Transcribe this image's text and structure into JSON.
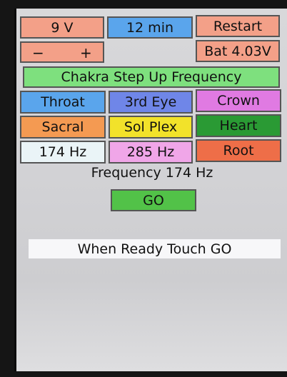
{
  "colors": {
    "salmon": "#f3a088",
    "blue": "#5aa5ec",
    "royal_blue": "#6f86e8",
    "magenta": "#e07ae2",
    "orange": "#f49a52",
    "yellow": "#f2e22a",
    "green": "#52c248",
    "dark_green": "#2a9a34",
    "light_green": "#7ee07e",
    "pink": "#f0a6e8",
    "red_orange": "#ee6e48",
    "white_blue": "#eaf4f7"
  },
  "top": {
    "voltage": "9 V",
    "timer": "12 min",
    "restart": "Restart",
    "minus": "−",
    "plus": "+",
    "battery": "Bat 4.03V"
  },
  "mode_banner": "Chakra Step Up Frequency",
  "chakras": {
    "throat": "Throat",
    "third_eye": "3rd Eye",
    "crown": "Crown",
    "sacral": "Sacral",
    "solar_plexus": "Sol Plex",
    "heart": "Heart",
    "root": "Root"
  },
  "frequencies": {
    "f1": "174 Hz",
    "f2": "285 Hz"
  },
  "status": {
    "frequency_readout": "Frequency 174 Hz",
    "go": "GO",
    "message": "When Ready Touch GO"
  }
}
